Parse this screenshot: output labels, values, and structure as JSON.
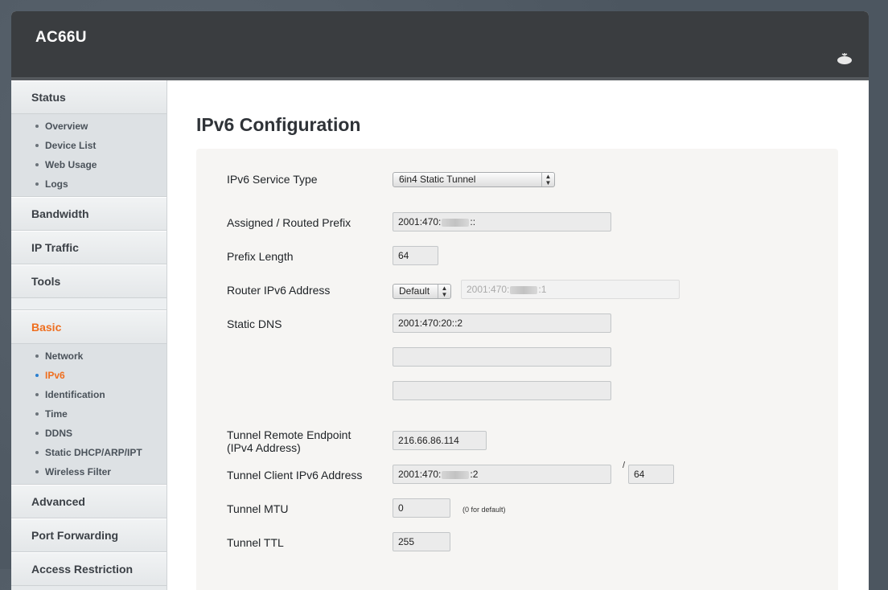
{
  "header": {
    "brand": "AC66U"
  },
  "sidebar": {
    "status": {
      "label": "Status",
      "items": [
        "Overview",
        "Device List",
        "Web Usage",
        "Logs"
      ]
    },
    "bandwidth": "Bandwidth",
    "ip_traffic": "IP Traffic",
    "tools": "Tools",
    "basic": {
      "label": "Basic",
      "items": [
        "Network",
        "IPv6",
        "Identification",
        "Time",
        "DDNS",
        "Static DHCP/ARP/IPT",
        "Wireless Filter"
      ],
      "active_item": "IPv6"
    },
    "advanced": "Advanced",
    "port_forwarding": "Port Forwarding",
    "access_restriction": "Access Restriction"
  },
  "main": {
    "title": "IPv6 Configuration",
    "service_type": {
      "label": "IPv6 Service Type",
      "value": "6in4 Static Tunnel"
    },
    "prefix": {
      "label": "Assigned / Routed Prefix",
      "value_start": "2001:470:",
      "value_end": "::"
    },
    "prefix_length": {
      "label": "Prefix Length",
      "value": "64"
    },
    "router_address": {
      "label": "Router IPv6 Address",
      "mode": "Default",
      "value_start": "2001:470:",
      "value_end": ":1"
    },
    "static_dns": {
      "label": "Static DNS",
      "values": [
        "2001:470:20::2",
        "",
        ""
      ]
    },
    "tunnel_remote": {
      "label_line1": "Tunnel Remote Endpoint",
      "label_line2": "(IPv4 Address)",
      "value": "216.66.86.114"
    },
    "tunnel_client": {
      "label": "Tunnel Client IPv6 Address",
      "value_start": "2001:470:",
      "value_end": ":2",
      "separator": "/",
      "prefix": "64"
    },
    "tunnel_mtu": {
      "label": "Tunnel MTU",
      "value": "0",
      "hint": "(0 for default)"
    },
    "tunnel_ttl": {
      "label": "Tunnel TTL",
      "value": "255"
    }
  }
}
